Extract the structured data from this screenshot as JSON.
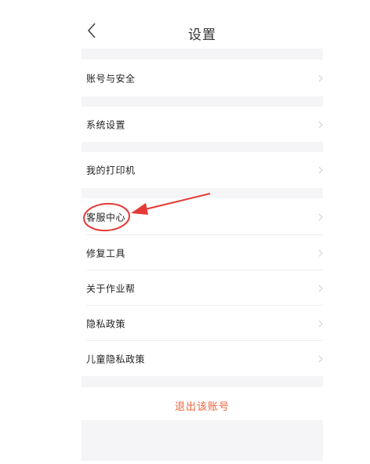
{
  "header": {
    "title": "设置",
    "back_icon": "chevron-left-icon"
  },
  "menu": {
    "account_security": "账号与安全",
    "system_settings": "系统设置",
    "my_printer": "我的打印机",
    "customer_service": "客服中心",
    "repair_tool": "修复工具",
    "about": "关于作业帮",
    "privacy_policy": "隐私政策",
    "child_privacy_policy": "儿童隐私政策"
  },
  "logout_label": "退出该账号",
  "colors": {
    "accent": "#f0653c",
    "annotation": "#e53935",
    "gap_background": "#f5f5f7"
  }
}
